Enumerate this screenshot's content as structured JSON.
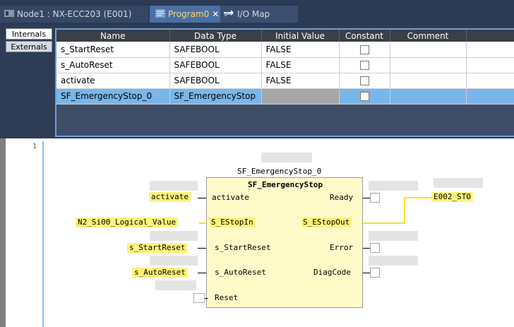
{
  "tabs": [
    {
      "label": "Node1 : NX-ECC203 (E001)",
      "active": false
    },
    {
      "label": "Program0",
      "active": true,
      "closable": true
    },
    {
      "label": "I/O Map",
      "active": false
    }
  ],
  "side_tabs": [
    "Internals",
    "Externals"
  ],
  "var_table": {
    "headers": [
      "Name",
      "Data Type",
      "Initial Value",
      "Constant",
      "Comment"
    ],
    "rows": [
      {
        "name": "s_StartReset",
        "type": "SAFEBOOL",
        "initial": "FALSE",
        "constant": false
      },
      {
        "name": "s_AutoReset",
        "type": "SAFEBOOL",
        "initial": "FALSE",
        "constant": false
      },
      {
        "name": "activate",
        "type": "SAFEBOOL",
        "initial": "FALSE",
        "constant": false
      },
      {
        "name": "SF_EmergencyStop_0",
        "type": "SF_EmergencyStop",
        "initial": "",
        "constant": false,
        "selected": true
      }
    ]
  },
  "ladder": {
    "rung_number": "1",
    "fb_instance": "SF_EmergencyStop_0",
    "fb_type": "SF_EmergencyStop",
    "inputs": [
      {
        "pin": "activate",
        "variable": "activate",
        "highlighted": true
      },
      {
        "pin": "S_EStopIn",
        "variable": "N2_Si00_Logical_Value",
        "highlighted": true
      },
      {
        "pin": "s_StartReset",
        "variable": "s_StartReset",
        "highlighted": true
      },
      {
        "pin": "s_AutoReset",
        "variable": "s_AutoReset",
        "highlighted": true
      },
      {
        "pin": "Reset",
        "variable": "",
        "highlighted": false
      }
    ],
    "outputs": [
      {
        "pin": "Ready",
        "variable": ""
      },
      {
        "pin": "S_EStopOut",
        "variable": "E002_STO",
        "highlighted": true
      },
      {
        "pin": "Error",
        "variable": ""
      },
      {
        "pin": "DiagCode",
        "variable": ""
      }
    ]
  },
  "colors": {
    "highlight": "#fff47a",
    "fb_fill": "#fffbc9",
    "selection": "#79b6ea",
    "active_tab_text": "#ffd76a"
  }
}
